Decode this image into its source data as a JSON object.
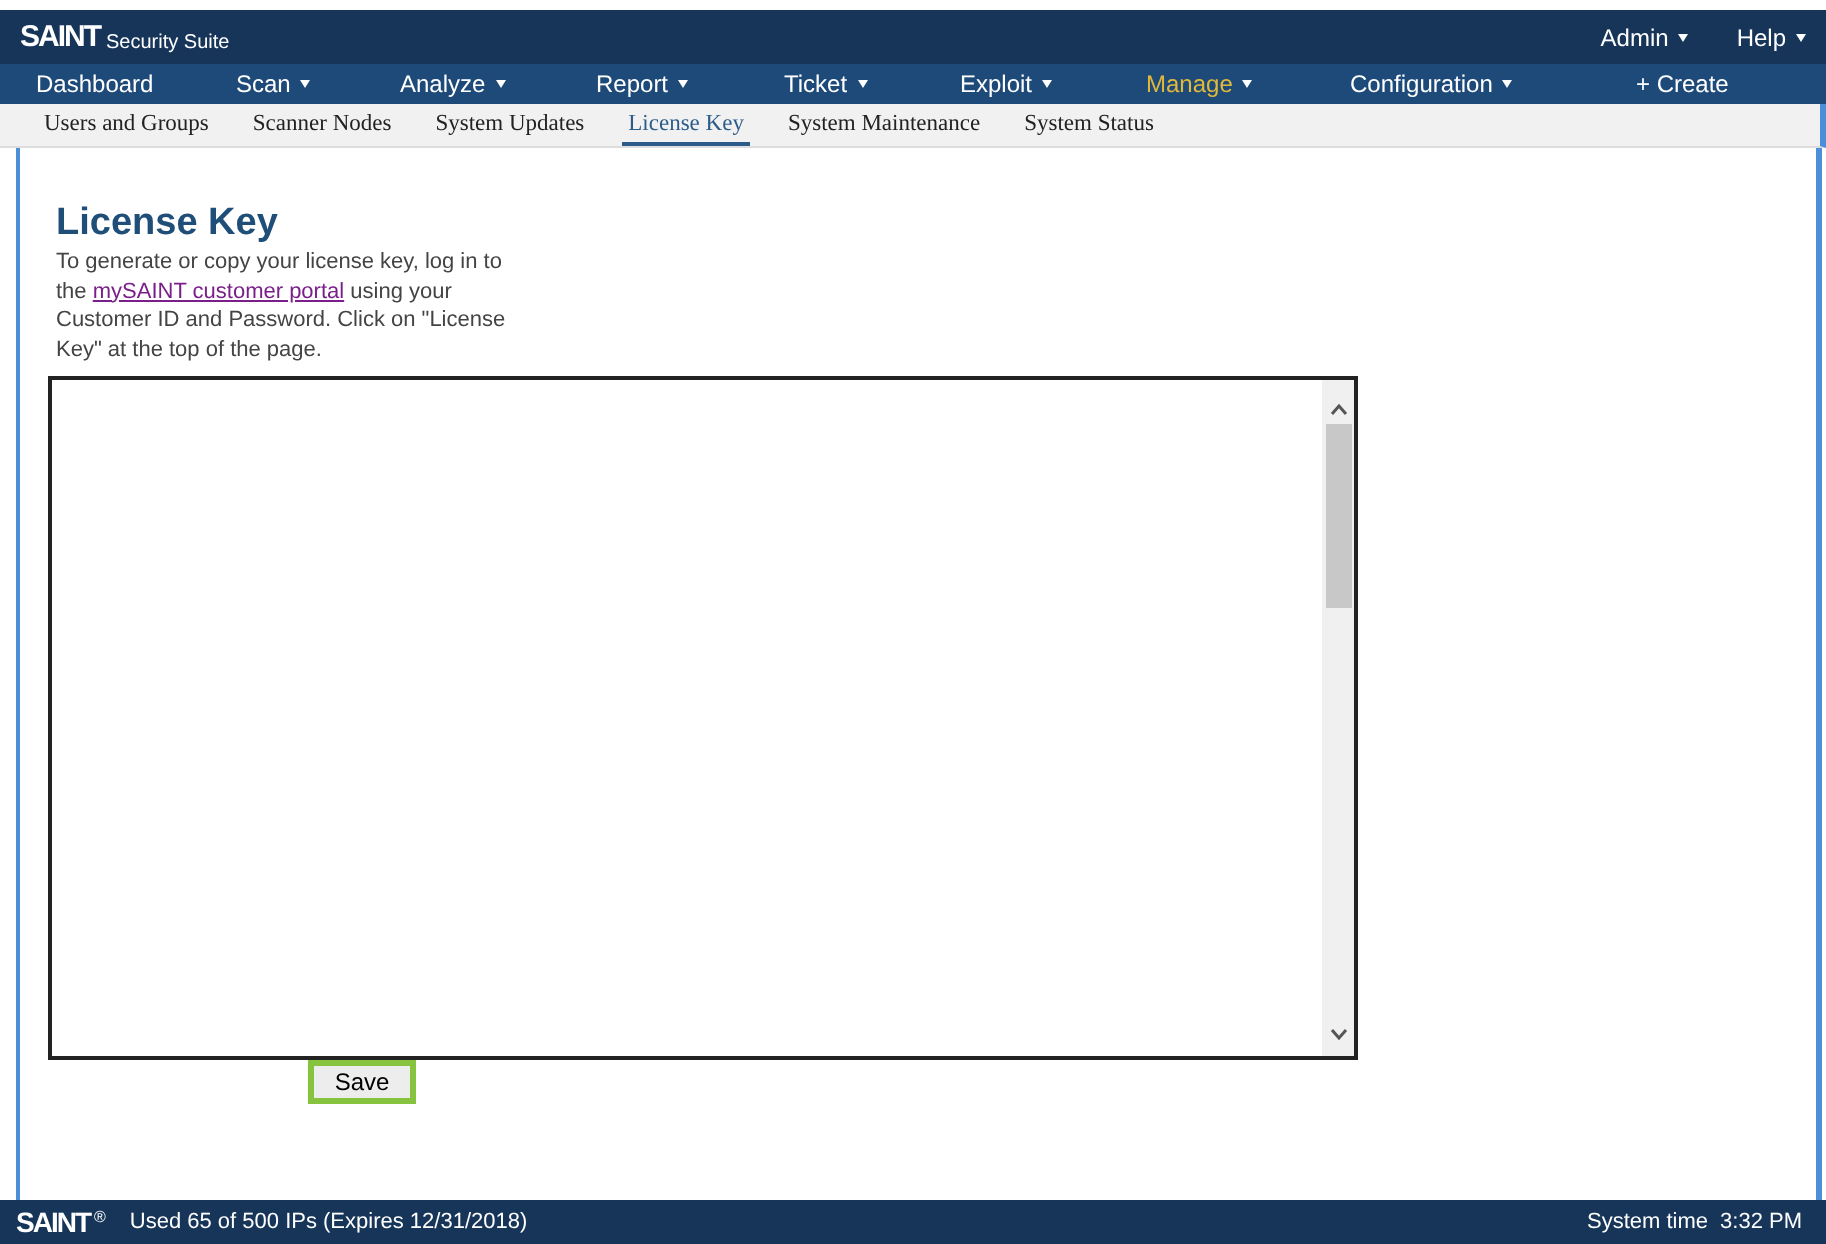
{
  "header": {
    "logo": "SAINT",
    "product": "Security Suite",
    "menus": [
      {
        "label": "Admin",
        "has_menu": true
      },
      {
        "label": "Help",
        "has_menu": true
      }
    ]
  },
  "nav": [
    {
      "label": "Dashboard",
      "has_menu": false,
      "selected": false
    },
    {
      "label": "Scan",
      "has_menu": true,
      "selected": false
    },
    {
      "label": "Analyze",
      "has_menu": true,
      "selected": false
    },
    {
      "label": "Report",
      "has_menu": true,
      "selected": false
    },
    {
      "label": "Ticket",
      "has_menu": true,
      "selected": false
    },
    {
      "label": "Exploit",
      "has_menu": true,
      "selected": false
    },
    {
      "label": "Manage",
      "has_menu": true,
      "selected": true
    },
    {
      "label": "Configuration",
      "has_menu": true,
      "selected": false
    },
    {
      "label": "+ Create",
      "has_menu": false,
      "selected": false
    }
  ],
  "subnav": [
    {
      "label": "Users and Groups",
      "selected": false
    },
    {
      "label": "Scanner Nodes",
      "selected": false
    },
    {
      "label": "System Updates",
      "selected": false
    },
    {
      "label": "License Key",
      "selected": true
    },
    {
      "label": "System Maintenance",
      "selected": false
    },
    {
      "label": "System Status",
      "selected": false
    }
  ],
  "page": {
    "title": "License Key",
    "intro_before": "To generate or copy your license key, log in to the",
    "link": "mySAINT customer portal",
    "intro_after": "using your Customer ID and Password. Click on \"License Key\" at the top of the page.",
    "save_button": "Save"
  },
  "status_bar": {
    "logo": "SAINT",
    "mark": "®",
    "usage": "Used 65 of 500 IPs (Expires 12/31/2018)",
    "time_label": "System time",
    "time": "3:32 PM"
  }
}
